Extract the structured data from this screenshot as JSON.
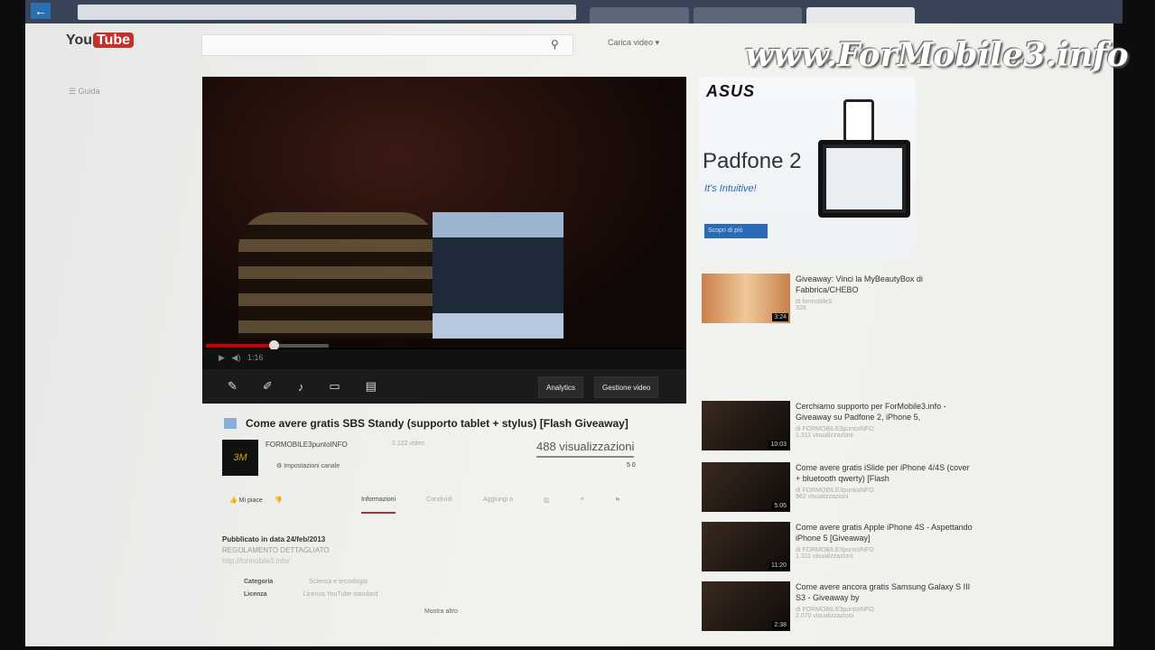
{
  "browser": {
    "back_icon": "arrow-left-icon",
    "tabs": [
      "",
      "",
      ""
    ]
  },
  "header": {
    "logo_you": "You",
    "logo_tube": "Tube",
    "search_icon": "search-icon",
    "upload": "Carica video ▾",
    "guide": "Guida"
  },
  "watermark": "www.ForMobile3.info",
  "player": {
    "time": "1:16",
    "toolbar_analytics": "Analytics",
    "toolbar_manage": "Gestione video",
    "progress": 0.12
  },
  "video": {
    "title": "Come avere gratis SBS Standy (supporto tablet + stylus) [Flash Giveaway]",
    "channel": "FORMOBILE3puntoINFO",
    "subs": "2.122 video",
    "subscribe": "Impostazioni canale",
    "views": "488 visualizzazioni",
    "likes": "5   0",
    "like": "Mi piace",
    "tabs": [
      "Informazioni",
      "Condividi",
      "Aggiungi a",
      "",
      "",
      ""
    ],
    "published": "Pubblicato in data 24/feb/2013",
    "rules": "REGOLAMENTO DETTAGLIATO",
    "link": "http://formobile3.info/",
    "category_label": "Categoria",
    "category": "Scienza e tecnologia",
    "license_label": "Licenza",
    "license": "Licenza YouTube standard",
    "more": "Mostra altro"
  },
  "ad": {
    "brand": "ASUS",
    "product": "Padfone 2",
    "tagline": "It's Intuitive!",
    "button": "Scopri di più"
  },
  "related": [
    {
      "title": "Giveaway: Vinci la MyBeautyBox di Fabbrica/CHEBO",
      "channel": "di formobile3",
      "views": "328",
      "duration": "3:24"
    },
    {
      "title": "Cerchiamo supporto per ForMobile3.info - Giveaway su Padfone 2, iPhone 5,",
      "channel": "di FORMOBILE3puntoINFO",
      "views": "1.311 visualizzazioni",
      "duration": "10:03"
    },
    {
      "title": "Come avere gratis iSlide per iPhone 4/4S (cover + bluetooth qwerty) [Flash",
      "channel": "di FORMOBILE3puntoINFO",
      "views": "962 visualizzazioni",
      "duration": "5:05"
    },
    {
      "title": "Come avere gratis Apple iPhone 4S - Aspettando iPhone 5 [Giveaway]",
      "channel": "di FORMOBILE3puntoINFO",
      "views": "1.311 visualizzazioni",
      "duration": "11:20"
    },
    {
      "title": "Come avere ancora gratis Samsung Galaxy S III S3 - Giveaway by",
      "channel": "di FORMOBILE3puntoINFO",
      "views": "2.070 visualizzazioni",
      "duration": "2:38"
    }
  ]
}
